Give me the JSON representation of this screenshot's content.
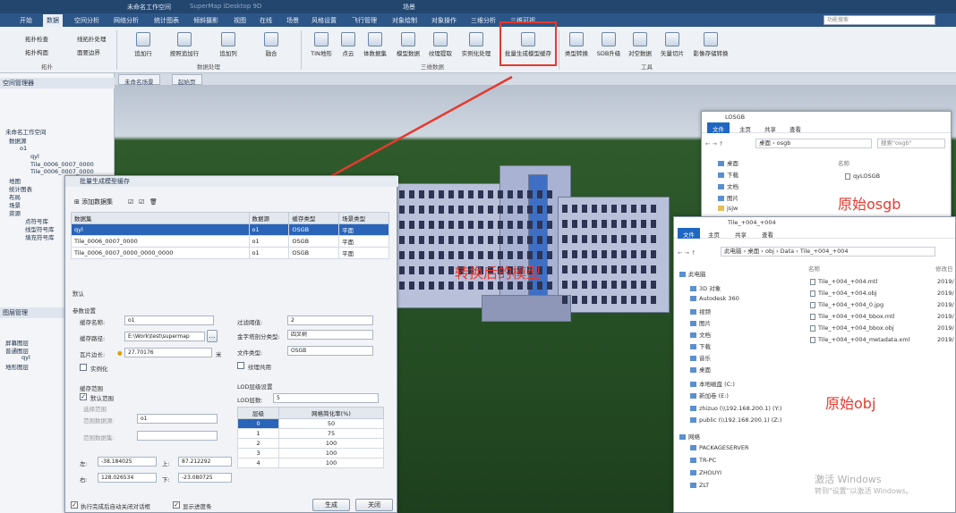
{
  "app": {
    "doc_title": "未命名工作空间",
    "app_name": "SuperMap iDesktop 9D",
    "context_title": "场景"
  },
  "menu": {
    "items": [
      "开始",
      "数据",
      "空间分析",
      "网络分析",
      "统计图表",
      "倾斜摄影",
      "视图",
      "在线",
      "场景",
      "风格设置",
      "飞行管理",
      "对象绘制",
      "对象操作",
      "三维分析",
      "三维可视"
    ],
    "active_index": 1,
    "search_placeholder": "功能搜索"
  },
  "ribbon": {
    "left_group": {
      "items": [
        "拓扑检查",
        "线拓扑处理",
        "拓扑构面",
        "面要边界"
      ],
      "label": "拓扑"
    },
    "data_group": {
      "items": [
        "追加行",
        "按照追加行",
        "追加列",
        "融合"
      ],
      "label": "数据处理"
    },
    "model_group": {
      "items": [
        "TIN地形",
        "点云",
        "体数据集",
        "模型数据",
        "纹理提取",
        "实例化处理",
        "批量生成模型缓存"
      ],
      "label": "三维数据"
    },
    "tools_group": {
      "items": [
        "类型转换",
        "SDB升级",
        "对空数据",
        "矢量切片",
        "影像存储转换"
      ],
      "label": "工具"
    }
  },
  "left_panel": {
    "workspace_header": "空间管理器",
    "tree": [
      "未命名工作空间",
      "数据源",
      "o1",
      "qyl",
      "Tile_0006_0007_0000",
      "Tile_0006_0007_0000",
      "地图",
      "统计图表",
      "布局",
      "场景",
      "资源",
      "点符号库",
      "线型符号库",
      "填充符号库"
    ],
    "layer_header": "图层管理",
    "layer_tree": [
      "屏幕图层",
      "普通图层",
      "qyl",
      "地形图层"
    ]
  },
  "tabs": [
    "未命名场景",
    "起始页"
  ],
  "dialog": {
    "title": "批量生成模型缓存",
    "add_dataset": "添加数据集",
    "columns": [
      "数据集",
      "数据源",
      "缓存类型",
      "场景类型"
    ],
    "rows": [
      {
        "dataset": "qyl",
        "source": "o1",
        "cache_type": "OSGB",
        "scene_type": "平面"
      },
      {
        "dataset": "Tile_0006_0007_0000",
        "source": "o1",
        "cache_type": "OSGB",
        "scene_type": "平面"
      },
      {
        "dataset": "Tile_0006_0007_0000_0000_0000",
        "source": "o1",
        "cache_type": "OSGB",
        "scene_type": "平面"
      }
    ],
    "default_label": "默认",
    "params_label": "参数设置",
    "cache_name_label": "缓存名称:",
    "cache_name": "o1",
    "cache_path_label": "缓存路径:",
    "cache_path": "E:\\Work\\test\\supermap",
    "tile_size_label": "瓦片边长:",
    "tile_size": "27.70176",
    "tile_unit": "米",
    "instancing_label": "实例化",
    "filter_label": "过滤阈值:",
    "filter_value": "2",
    "split_type_label": "金字塔剖分类型:",
    "split_type": "四叉树",
    "file_type_label": "文件类型:",
    "file_type": "OSGB",
    "texture_share_label": "纹理共用",
    "cache_range_label": "缓存范围",
    "default_range_label": "默认范围",
    "select_range_label": "选择范围",
    "range_source_label": "范围数据源:",
    "range_source": "o1",
    "range_dataset_label": "范围数据集:",
    "lod_settings_label": "LOD层级设置",
    "lod_count_label": "LOD层数:",
    "lod_count": "5",
    "lod_columns": [
      "层级",
      "网格简化率(%)"
    ],
    "lod_rows": [
      [
        "0",
        "50"
      ],
      [
        "1",
        "75"
      ],
      [
        "2",
        "100"
      ],
      [
        "3",
        "100"
      ],
      [
        "4",
        "100"
      ]
    ],
    "left_label": "左:",
    "left_value": "-38.184025",
    "top_label": "上:",
    "top_value": "87.212292",
    "right_label": "右:",
    "right_value": "128.026534",
    "bottom_label": "下:",
    "bottom_value": "-23.080725",
    "auto_close_label": "执行完成后自动关闭对话框",
    "show_progress_label": "显示进度条",
    "generate_button": "生成",
    "close_button": "关闭"
  },
  "explorer1": {
    "title": "LOSGB",
    "menu": [
      "文件",
      "主页",
      "共享",
      "查看"
    ],
    "path": [
      "桌面",
      "osgb"
    ],
    "search": "搜索\"osgb\"",
    "nav": [
      "桌面",
      "下载",
      "文档",
      "图片",
      "jsjw"
    ],
    "column_name": "名称",
    "files": [
      "qyLOSGB"
    ]
  },
  "explorer2": {
    "title": "Tile_+004_+004",
    "menu": [
      "文件",
      "主页",
      "共享",
      "查看"
    ],
    "path": [
      "此电脑",
      "桌面",
      "obj",
      "Data",
      "Tile_+004_+004"
    ],
    "nav": [
      "此电脑",
      "3D 对象",
      "Autodesk 360",
      "视频",
      "图片",
      "文档",
      "下载",
      "音乐",
      "桌面",
      "本地磁盘 (C:)",
      "新加卷 (E:)",
      "zhizuo (\\\\192.168.200.1) (Y:)",
      "public (\\\\192.168.200.1) (Z:)",
      "网络",
      "PACKAGESERVER",
      "TR-PC",
      "ZHOUYI",
      "ZLT"
    ],
    "column_name": "名称",
    "column_modified": "修改日",
    "files": [
      "Tile_+004_+004.mtl",
      "Tile_+004_+004.obj",
      "Tile_+004_+004_0.jpg",
      "Tile_+004_+004_bbox.mtl",
      "Tile_+004_+004_bbox.obj",
      "Tile_+004_+004_metadata.xml"
    ],
    "dates": [
      "2019/",
      "2019/",
      "2019/",
      "2019/",
      "2019/",
      "2019/"
    ]
  },
  "annotations": {
    "osgb": "原始osgb",
    "obj": "原始obj",
    "model": "转换后的模型"
  },
  "watermark": {
    "line1": "激活 Windows",
    "line2": "转到\"设置\"以激活 Windows。"
  },
  "colors": {
    "accent_red": "#e53a2f",
    "selection_blue": "#2a64b8",
    "menubar_blue": "#2d5688"
  }
}
